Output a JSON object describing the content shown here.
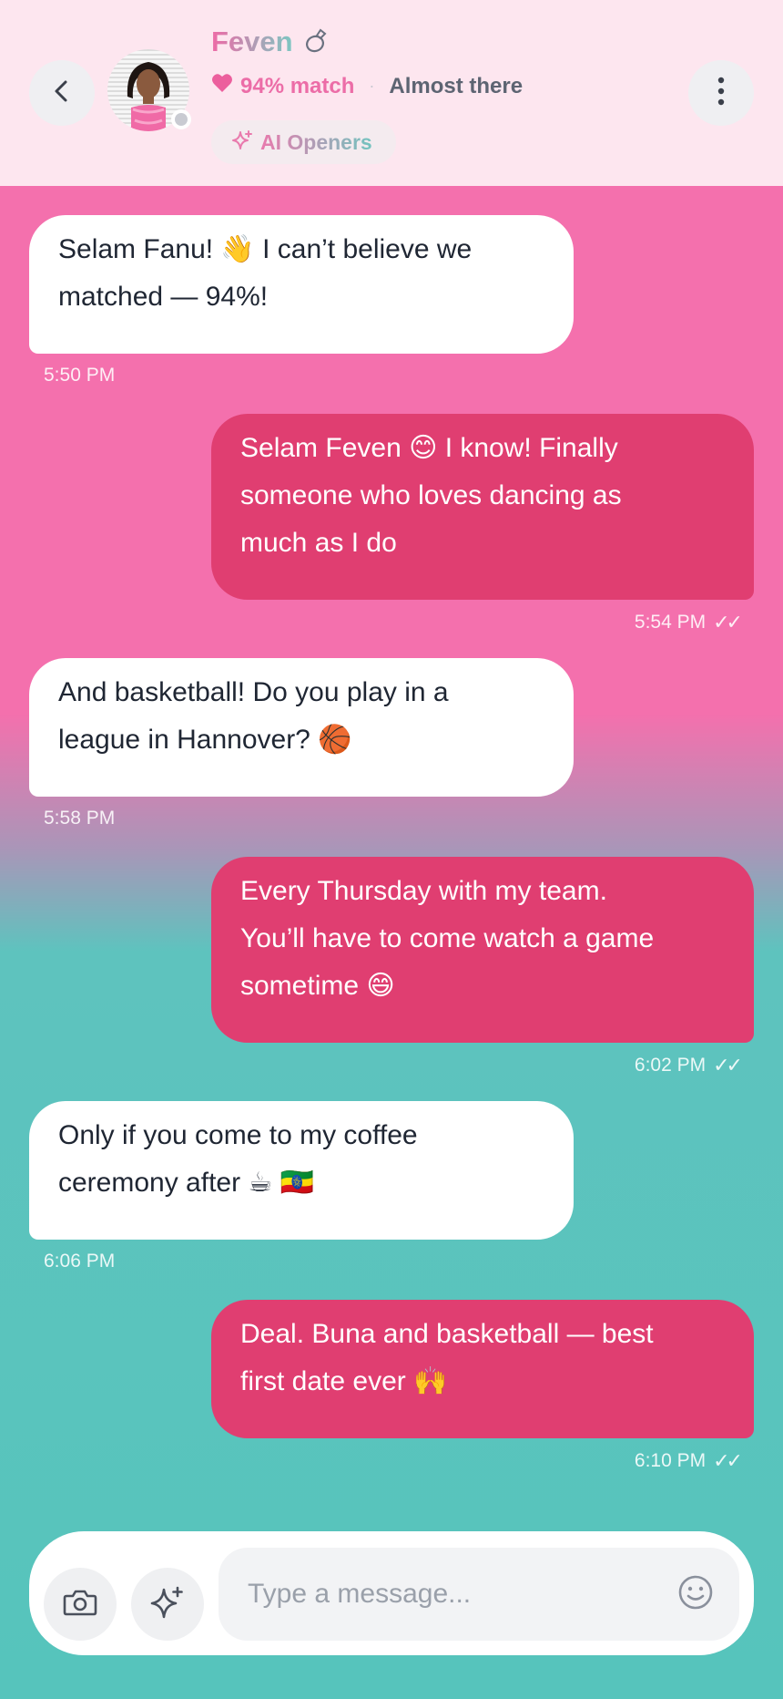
{
  "header": {
    "name": "Feven",
    "name_icon": "ring-icon",
    "match_text": "94% match",
    "separator": "·",
    "status": "Almost there",
    "ai_openers": "AI Openers",
    "colors": {
      "background": "#fde6ef",
      "accent_pink": "#ec6da7",
      "accent_teal": "#72c4bf"
    }
  },
  "messages": [
    {
      "direction": "in",
      "line1": "Selam Fanu! 👋  I can’t believe we",
      "line2": "matched — 94%!",
      "time": "5:50 PM"
    },
    {
      "direction": "out",
      "line1": "Selam Feven 😊  I know! Finally",
      "line2": "someone who loves dancing as",
      "line3": "much as I do",
      "time": "5:54 PM",
      "ticks": "✓✓"
    },
    {
      "direction": "in",
      "line1": "And basketball! Do you play in a",
      "line2": "league in Hannover? 🏀",
      "time": "5:58 PM"
    },
    {
      "direction": "out",
      "line1": "Every Thursday with my team.",
      "line2": "You’ll have to come watch a game",
      "line3": "sometime 😄",
      "time": "6:02 PM",
      "ticks": "✓✓"
    },
    {
      "direction": "in",
      "line1": "Only if you come to my coffee",
      "line2": "ceremony after ☕ 🇪🇹",
      "time": "6:06 PM"
    },
    {
      "direction": "out",
      "line1": "Deal. Buna and basketball — best",
      "line2": "first date ever 🙌",
      "time": "6:10 PM",
      "ticks": "✓✓"
    }
  ],
  "composer": {
    "placeholder": "Type a message...",
    "icons": [
      "camera-icon",
      "sparkle-icon",
      "smiley-icon"
    ]
  },
  "colors": {
    "incoming_bubble": "#ffffff",
    "outgoing_bubble": "#e03e71",
    "bg_top": "#f470ad",
    "bg_bottom": "#56c4bc"
  }
}
